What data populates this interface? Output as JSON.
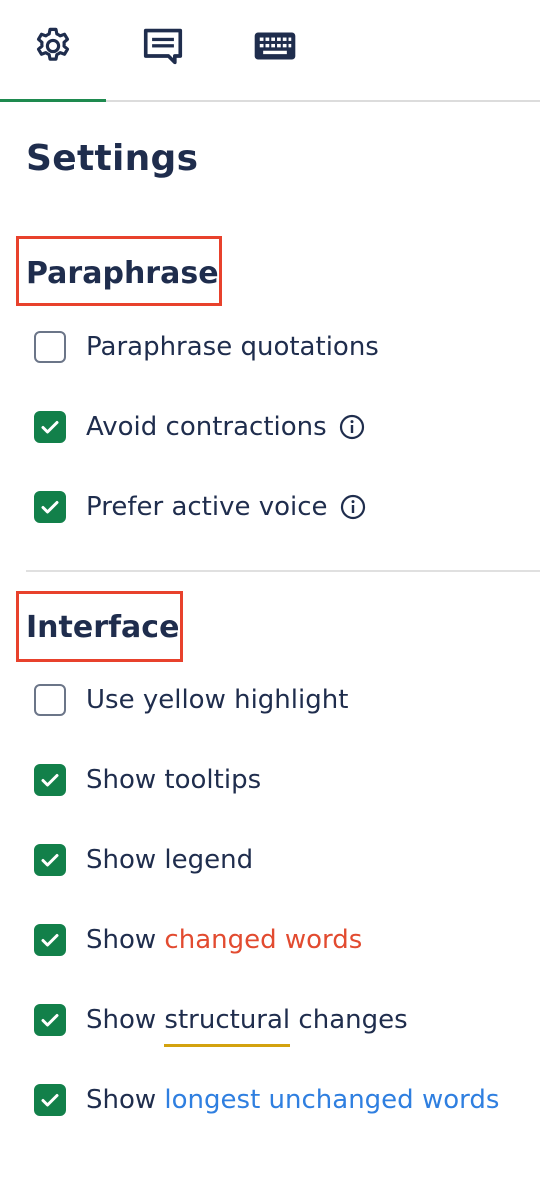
{
  "tabs": [
    {
      "name": "settings",
      "icon": "gear-icon",
      "active": true
    },
    {
      "name": "chat",
      "icon": "chat-icon",
      "active": false
    },
    {
      "name": "keyboard",
      "icon": "keyboard-icon",
      "active": false
    }
  ],
  "page": {
    "title": "Settings"
  },
  "colors": {
    "accent": "#1e8a4f",
    "checkbox_checked": "#12804a",
    "text": "#1f2d4d",
    "changed_words": "#e24b30",
    "structural_underline": "#d3a20f",
    "longest_unchanged": "#2f7fe0",
    "highlight_box": "#e8412c"
  },
  "paraphrase": {
    "title": "Paraphrase",
    "options": [
      {
        "label": "Paraphrase quotations",
        "checked": false
      },
      {
        "label": "Avoid contractions",
        "checked": true,
        "info_icon": "info-icon"
      },
      {
        "label": "Prefer active voice",
        "checked": true,
        "info_icon": "info-icon",
        "focused": true
      }
    ]
  },
  "interface": {
    "title": "Interface",
    "options": [
      {
        "label": "Use yellow highlight",
        "checked": false
      },
      {
        "label": "Show tooltips",
        "checked": true
      },
      {
        "label": "Show legend",
        "checked": true
      },
      {
        "prefix": "Show",
        "highlight": "changed words",
        "checked": true
      },
      {
        "prefix": "Show",
        "highlight": "structural",
        "suffix": "changes",
        "checked": true
      },
      {
        "prefix": "Show",
        "highlight": "longest unchanged words",
        "checked": true
      }
    ]
  }
}
